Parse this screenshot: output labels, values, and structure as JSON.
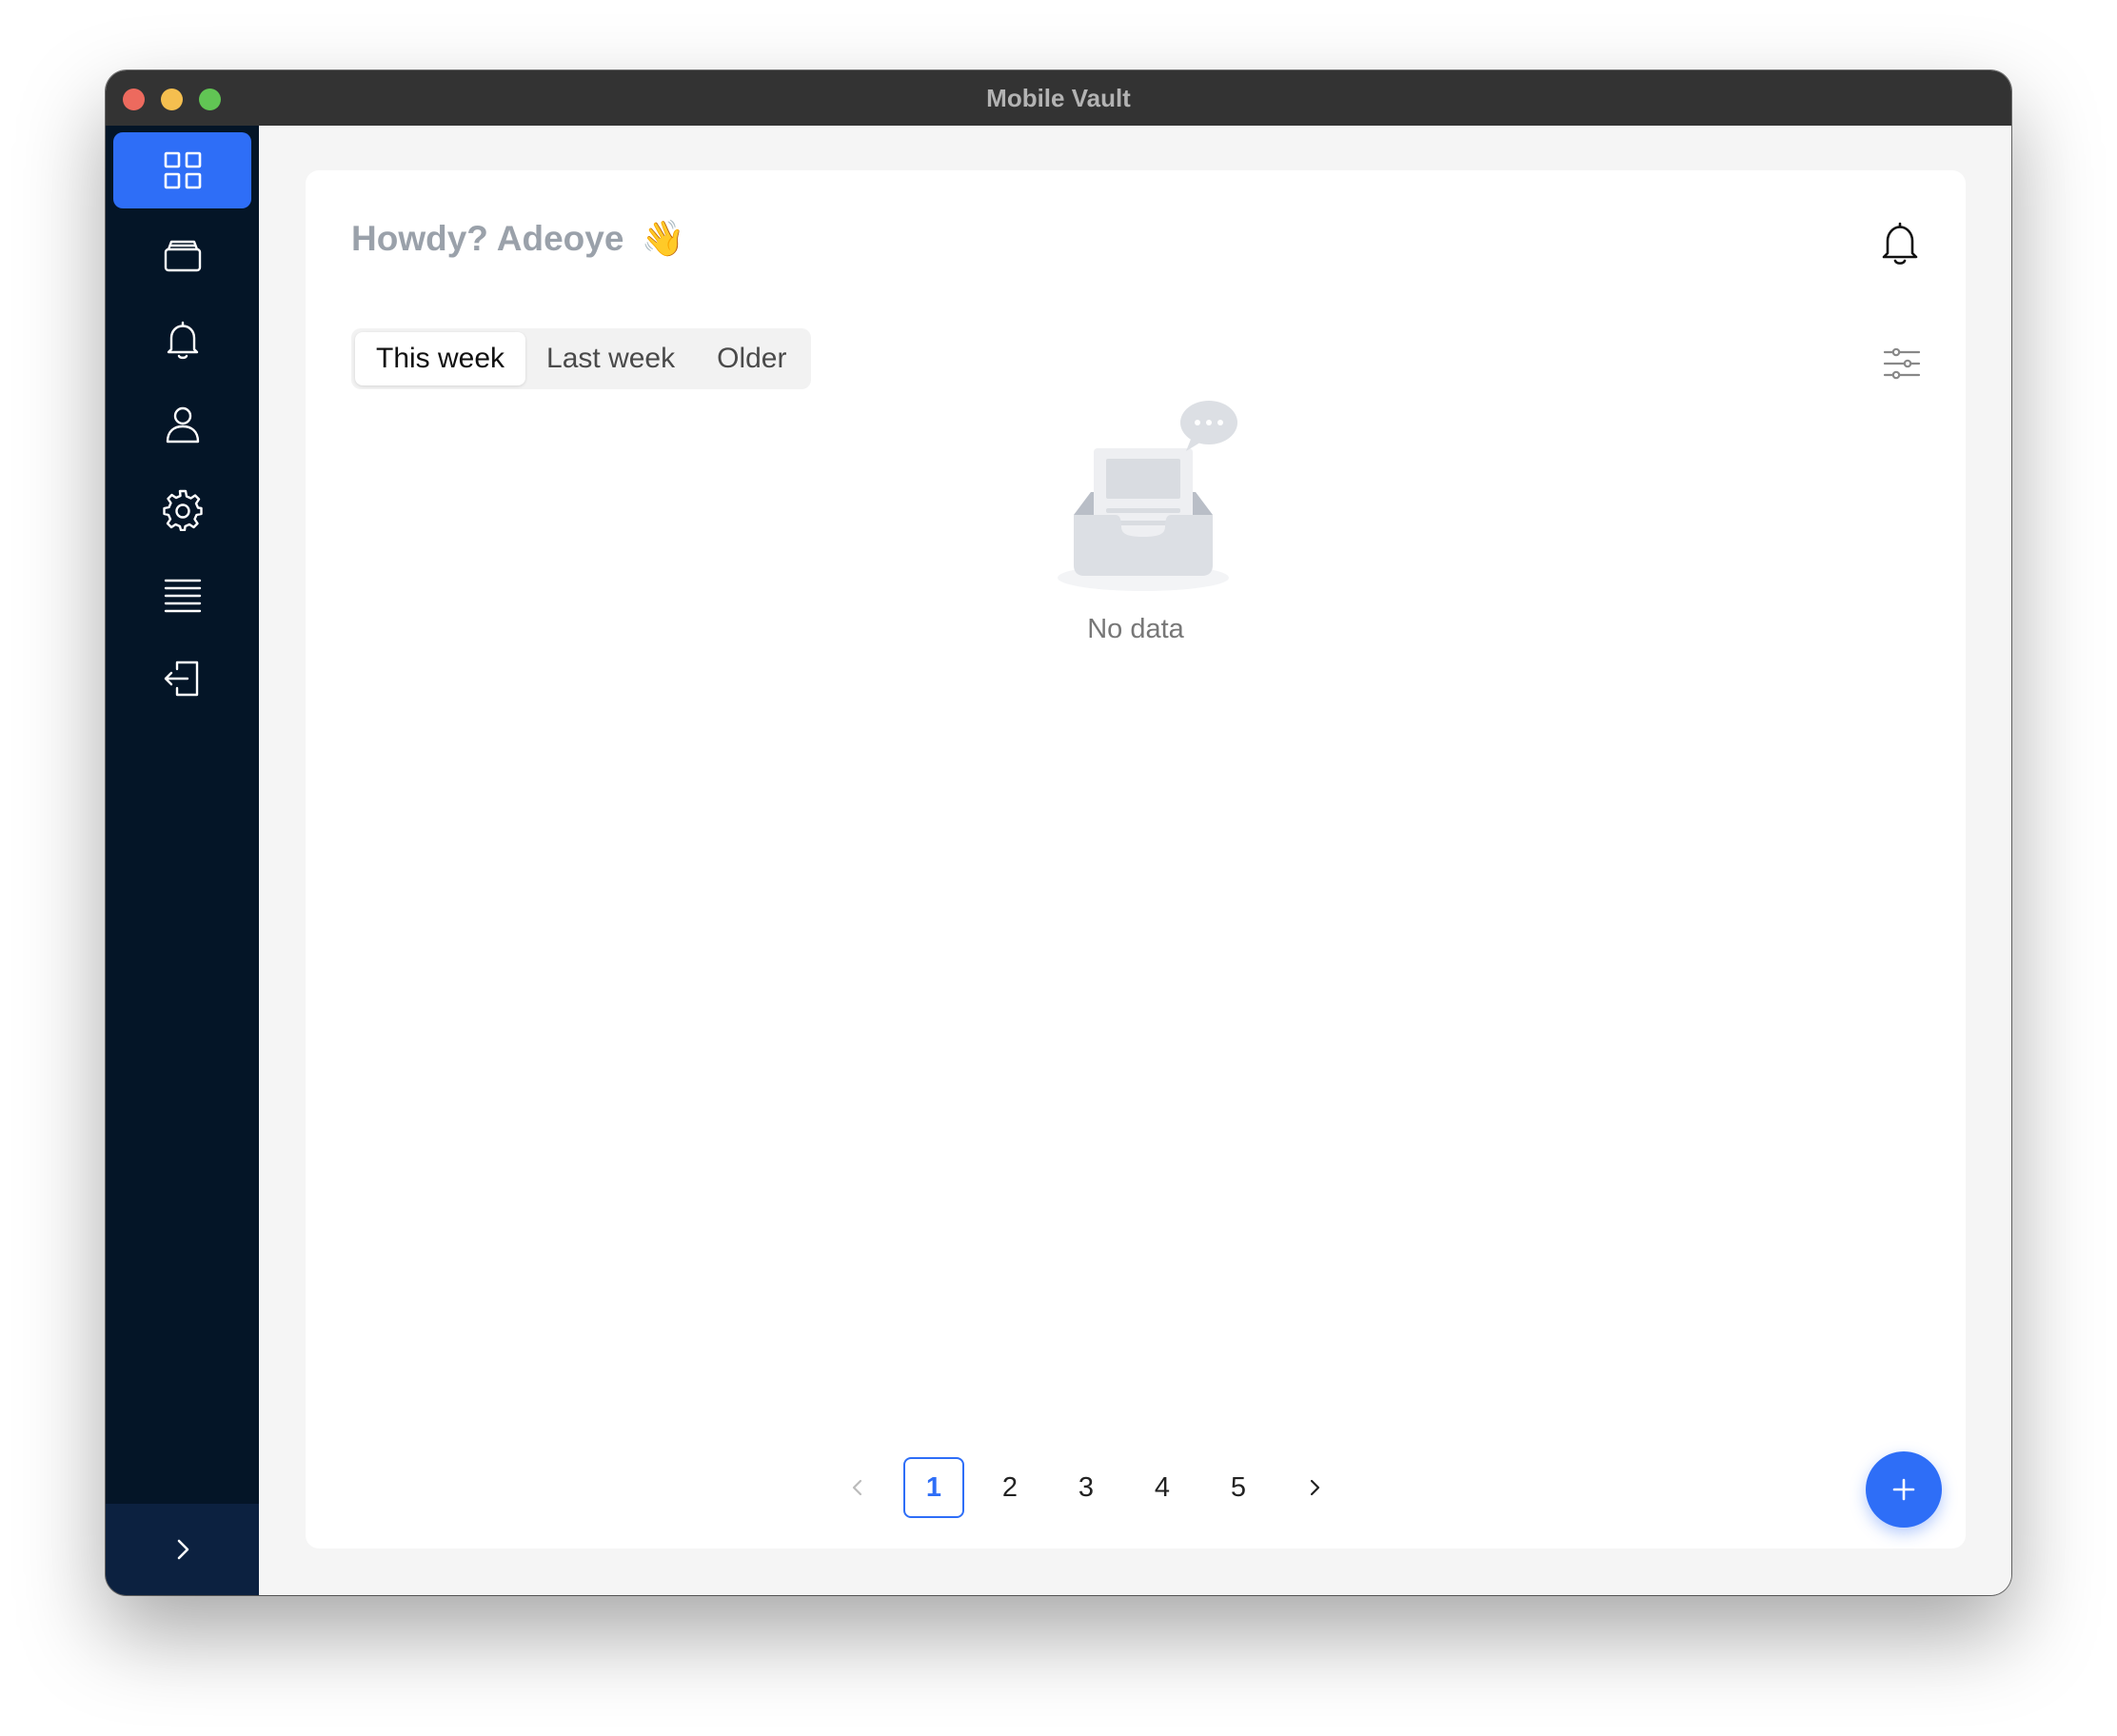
{
  "window": {
    "title": "Mobile Vault"
  },
  "sidebar": {
    "items": [
      {
        "icon": "dashboard-grid-icon",
        "active": true
      },
      {
        "icon": "wallet-icon",
        "active": false
      },
      {
        "icon": "bell-icon",
        "active": false
      },
      {
        "icon": "user-icon",
        "active": false
      },
      {
        "icon": "gear-icon",
        "active": false
      },
      {
        "icon": "list-icon",
        "active": false
      },
      {
        "icon": "logout-icon",
        "active": false
      }
    ],
    "footer_icon": "chevron-right-icon"
  },
  "main": {
    "greeting": "Howdy? Adeoye",
    "greeting_emoji": "👋",
    "tabs": [
      {
        "label": "This week",
        "active": true
      },
      {
        "label": "Last week",
        "active": false
      },
      {
        "label": "Older",
        "active": false
      }
    ],
    "empty_state": {
      "text": "No data"
    }
  },
  "pagination": {
    "pages": [
      "1",
      "2",
      "3",
      "4",
      "5"
    ],
    "current": "1"
  },
  "fab": {
    "label": "+"
  },
  "colors": {
    "accent": "#2e6ef7",
    "sidebar_bg": "#041527",
    "titlebar_bg": "#333333"
  }
}
